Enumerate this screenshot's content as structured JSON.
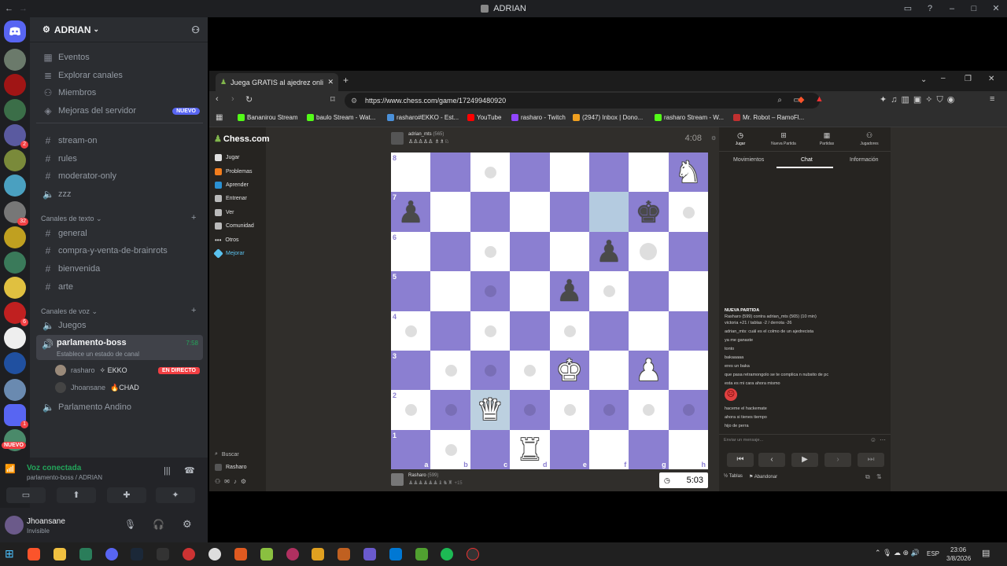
{
  "window": {
    "title": "ADRIAN"
  },
  "server": {
    "name": "ADRIAN"
  },
  "server_rail_badges": [
    "2",
    "32",
    "6",
    "1"
  ],
  "server_rail_new": "NUEVO",
  "sidebar": {
    "top_items": [
      "Eventos",
      "Explorar canales",
      "Miembros",
      "Mejoras del servidor"
    ],
    "new_badge": "NUEVO",
    "channels": [
      "stream-on",
      "rules",
      "moderator-only",
      "zzz"
    ],
    "text_category": "Canales de texto",
    "text_channels": [
      "general",
      "compra-y-venta-de-brainrots",
      "bienvenida",
      "arte"
    ],
    "voice_category": "Canales de voz",
    "voice_channels": [
      "Juegos"
    ],
    "active_voice": {
      "name": "parlamento-boss",
      "time": "7:58",
      "status": "Establece un estado de canal"
    },
    "voice_users": [
      {
        "name": "rasharo",
        "tag": "EKKO",
        "live": "EN DIRECTO"
      },
      {
        "name": "Jhoansane",
        "tag": "CHAD"
      }
    ],
    "other_voice": "Parlamento Andino"
  },
  "voice_panel": {
    "status": "Voz conectada",
    "location": "parlamento-boss / ADRIAN"
  },
  "user_panel": {
    "name": "Jhoansane",
    "status": "Invisible"
  },
  "browser": {
    "tab_title": "Juega GRATIS al ajedrez onli...",
    "url": "https://www.chess.com/game/172499480920",
    "bookmarks": [
      "Bananirou Stream",
      "baulo Stream - Wat...",
      "rasharo#EKKO - Est...",
      "YouTube",
      "rasharo - Twitch",
      "(2947) Inbox | Dono...",
      "rasharo Stream - W...",
      "Mr. Robot – RamoFl..."
    ]
  },
  "chess": {
    "logo": "Chess.com",
    "nav": [
      "Jugar",
      "Problemas",
      "Aprender",
      "Entrenar",
      "Ver",
      "Comunidad",
      "Otros",
      "Mejorar"
    ],
    "nav_bottom": [
      "Buscar",
      "Rasharo"
    ],
    "top_player": {
      "name": "adrian_mts",
      "rating": "(565)",
      "clock": "4:08"
    },
    "bottom_player": {
      "name": "Rasharo",
      "rating": "(599)",
      "plus": "+15",
      "clock": "5:03"
    },
    "ranks": [
      "8",
      "7",
      "6",
      "5",
      "4",
      "3",
      "2",
      "1"
    ],
    "files": [
      "a",
      "b",
      "c",
      "d",
      "e",
      "f",
      "g",
      "h"
    ],
    "panel_tabs": [
      "Jugar",
      "Nueva Partida",
      "Partidas",
      "Jugadores"
    ],
    "sub_tabs": [
      "Movimientos",
      "Chat",
      "Información"
    ],
    "chat": {
      "header": "NUEVA PARTIDA",
      "line1": "Rasharo (599) contra adrian_mts (565) (10 min)",
      "line2": "victoria +21 / tablas -2 / derrota -26",
      "messages": [
        "adrian_mts: cuál es el colmo de un ajedrecista",
        "ya me ganaste",
        "tonto",
        "bakaaaaa",
        "eres un baka",
        "que pasa retramongolo se te complica n nubsito de pc",
        "esta es mi cara ahora mismo"
      ],
      "messages2": [
        "haceme el hackemate",
        "ahora si tienes tiempo",
        "hijo de perra"
      ],
      "placeholder": "Enviar un mensaje..."
    },
    "footer": {
      "draw": "Tablas",
      "resign": "Abandonar"
    }
  },
  "taskbar": {
    "lang": "ESP",
    "time": "23:06",
    "date": "3/8/2026"
  }
}
